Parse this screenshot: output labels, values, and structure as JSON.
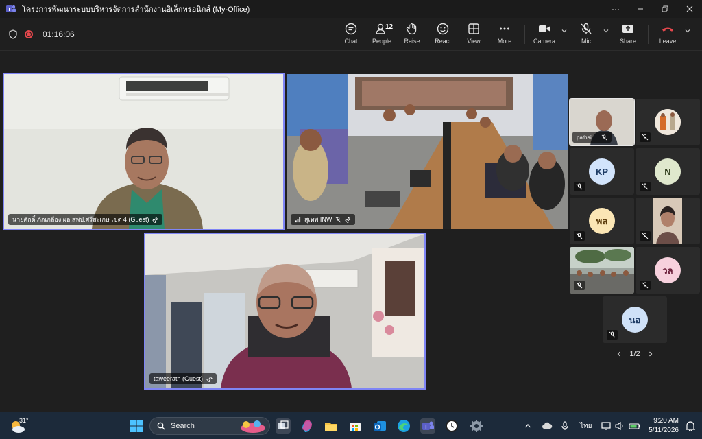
{
  "window": {
    "title": "โครงการพัฒนาระบบบริหารจัดการสำนักงานอิเล็กทรอนิกส์ (My-Office)",
    "more": "···"
  },
  "toolbar": {
    "timer": "01:16:06",
    "chat": "Chat",
    "people": "People",
    "people_count": "12",
    "raise": "Raise",
    "react": "React",
    "view": "View",
    "more": "More",
    "camera": "Camera",
    "mic": "Mic",
    "share": "Share",
    "leave": "Leave"
  },
  "stage": {
    "tile1_name": "นายศักดิ์ ภักเกลื่อง ผอ.สพป.ศรีสะเกษ เขต 4 (Guest)",
    "tile2_name": "สุเทพ INW",
    "tile3_name": "taweerath (Guest)"
  },
  "gallery": {
    "pathai_name": "pathai ...",
    "kp": "KP",
    "n": "N",
    "pl": "พล",
    "wl": "วล",
    "no": "นอ",
    "pager": "1/2"
  },
  "taskbar": {
    "temp": "31°",
    "search": "Search",
    "lang": "ไทย",
    "time": "9:20 AM",
    "date": "5/11/2026"
  },
  "colors": {
    "accent": "#7f85f5",
    "leave": "#e7484d",
    "kp_bg": "#d2e4fb",
    "n_bg": "#dfe8cd",
    "pl_bg": "#fbe6b5",
    "wl_bg": "#f7d1dd",
    "no_bg": "#cfe1f7"
  }
}
